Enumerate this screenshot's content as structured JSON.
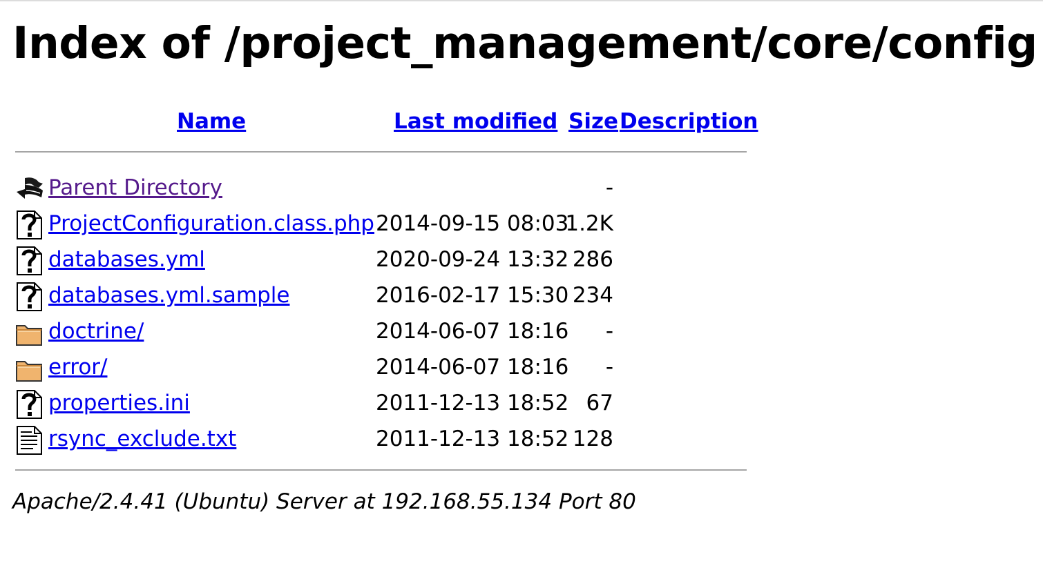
{
  "title": "Index of /project_management/core/config",
  "columns": {
    "name": "Name",
    "last_modified": "Last modified",
    "size": "Size",
    "description": "Description"
  },
  "rows": [
    {
      "icon": "back-arrow-icon",
      "name": "Parent Directory",
      "date": "",
      "size": "-",
      "visited": true
    },
    {
      "icon": "unknown-file-icon",
      "name": "ProjectConfiguration.class.php",
      "date": "2014-09-15 08:03",
      "size": "1.2K"
    },
    {
      "icon": "unknown-file-icon",
      "name": "databases.yml",
      "date": "2020-09-24 13:32",
      "size": "286"
    },
    {
      "icon": "unknown-file-icon",
      "name": "databases.yml.sample",
      "date": "2016-02-17 15:30",
      "size": "234"
    },
    {
      "icon": "folder-icon",
      "name": "doctrine/",
      "date": "2014-06-07 18:16",
      "size": "-"
    },
    {
      "icon": "folder-icon",
      "name": "error/",
      "date": "2014-06-07 18:16",
      "size": "-"
    },
    {
      "icon": "unknown-file-icon",
      "name": "properties.ini",
      "date": "2011-12-13 18:52",
      "size": "67"
    },
    {
      "icon": "text-file-icon",
      "name": "rsync_exclude.txt",
      "date": "2011-12-13 18:52",
      "size": "128"
    }
  ],
  "footer": "Apache/2.4.41 (Ubuntu) Server at 192.168.55.134 Port 80",
  "colors": {
    "link": "#0000ee",
    "visited_link": "#551a8b",
    "folder": "#f0b46e",
    "rule": "#a5a5a5"
  }
}
